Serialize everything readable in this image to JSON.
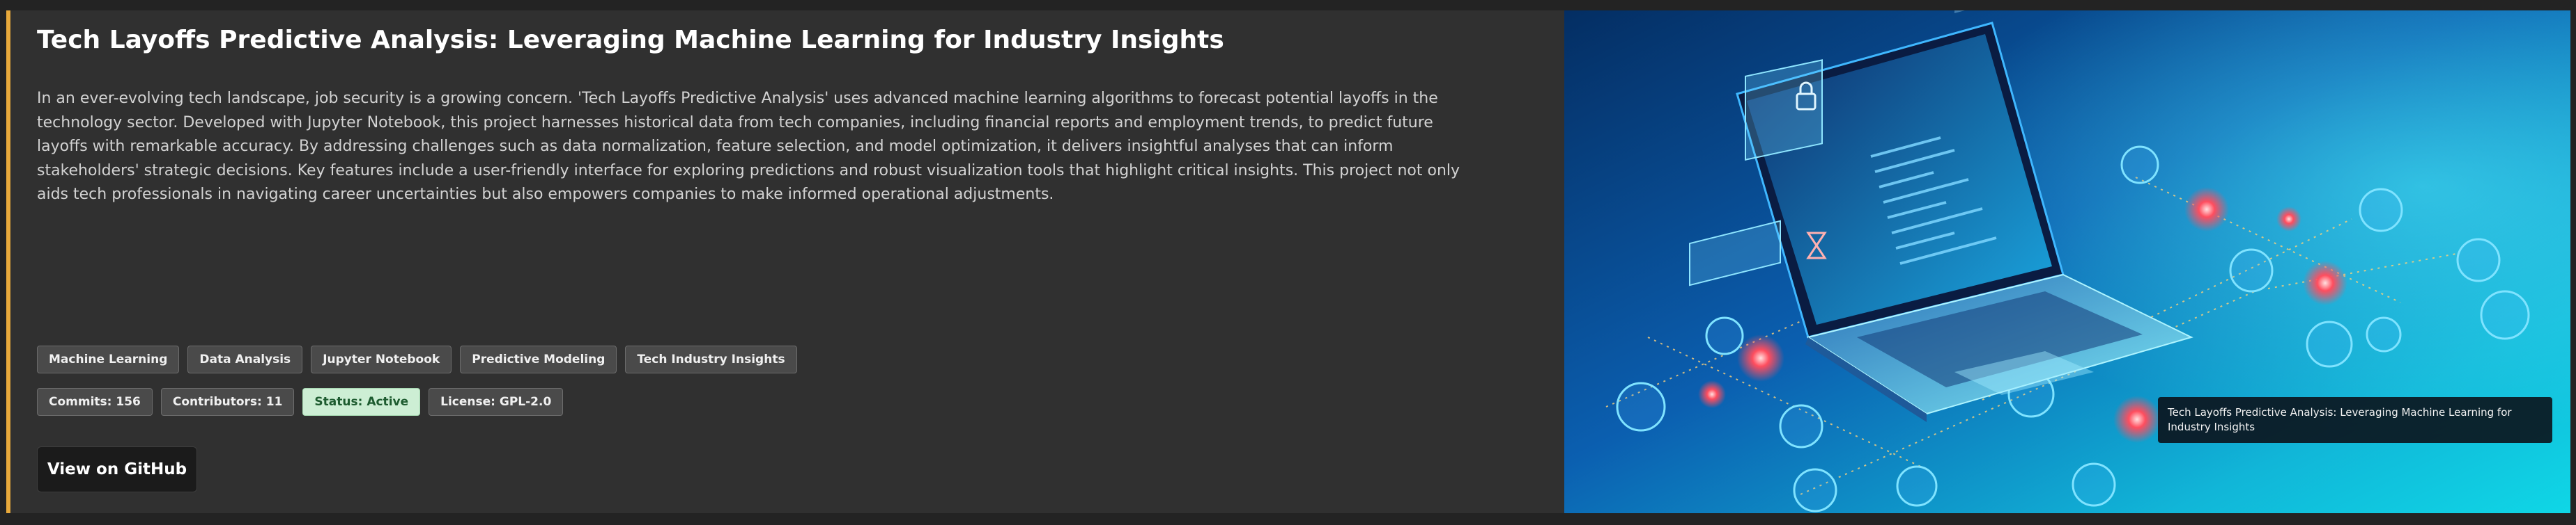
{
  "project": {
    "title": "Tech Layoffs Predictive Analysis: Leveraging Machine Learning for Industry Insights",
    "description": "In an ever-evolving tech landscape, job security is a growing concern. 'Tech Layoffs Predictive Analysis' uses advanced machine learning algorithms to forecast potential layoffs in the technology sector. Developed with Jupyter Notebook, this project harnesses historical data from tech companies, including financial reports and employment trends, to predict future layoffs with remarkable accuracy. By addressing challenges such as data normalization, feature selection, and model optimization, it delivers insightful analyses that can inform stakeholders' strategic decisions. Key features include a user-friendly interface for exploring predictions and robust visualization tools that highlight critical insights. This project not only aids tech professionals in navigating career uncertainties but also empowers companies to make informed operational adjustments.",
    "tags": [
      "Machine Learning",
      "Data Analysis",
      "Jupyter Notebook",
      "Predictive Modeling",
      "Tech Industry Insights"
    ],
    "stats": {
      "commits": "Commits: 156",
      "contributors": "Contributors: 11",
      "status": "Status: Active",
      "license": "License: GPL-2.0"
    },
    "github_button": "View on GitHub",
    "image_caption": "Tech Layoffs Predictive Analysis: Leveraging Machine Learning for Industry Insights"
  },
  "colors": {
    "accent_border": "#e8a93b",
    "card_background": "#303030",
    "status_active_bg": "#cdeed4"
  },
  "icons": [
    "laptop-illustration",
    "lock-icon",
    "hourglass-icon",
    "network-node-icons"
  ]
}
